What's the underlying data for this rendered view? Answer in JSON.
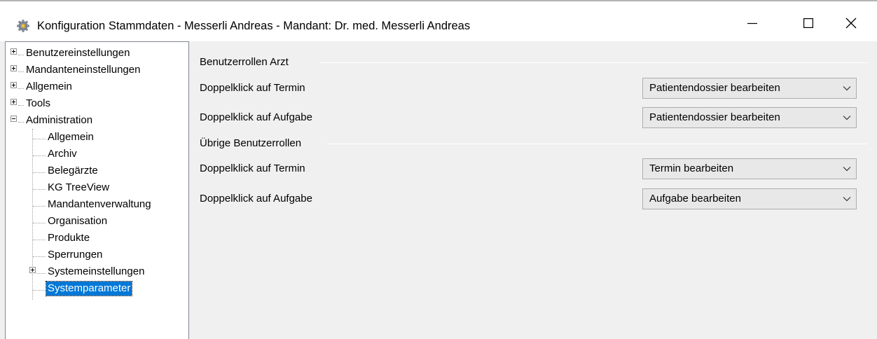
{
  "window": {
    "title": "Konfiguration Stammdaten - Messerli Andreas - Mandant: Dr. med. Messerli Andreas"
  },
  "tree": {
    "nodes": [
      {
        "label": "Benutzereinstellungen",
        "expander": "plus"
      },
      {
        "label": "Mandanteneinstellungen",
        "expander": "plus"
      },
      {
        "label": "Allgemein",
        "expander": "plus"
      },
      {
        "label": "Tools",
        "expander": "plus"
      },
      {
        "label": "Administration",
        "expander": "minus"
      }
    ],
    "admin_children": [
      {
        "label": "Allgemein"
      },
      {
        "label": "Archiv"
      },
      {
        "label": "Belegärzte"
      },
      {
        "label": "KG TreeView"
      },
      {
        "label": "Mandantenverwaltung"
      },
      {
        "label": "Organisation"
      },
      {
        "label": "Produkte"
      },
      {
        "label": "Sperrungen"
      },
      {
        "label": "Systemeinstellungen",
        "expander": "plus"
      },
      {
        "label": "Systemparameter",
        "selected": true
      }
    ]
  },
  "groups": [
    {
      "title": "Benutzerrollen Arzt",
      "fields": [
        {
          "label": "Doppelklick auf Termin",
          "value": "Patientendossier bearbeiten"
        },
        {
          "label": "Doppelklick auf Aufgabe",
          "value": "Patientendossier bearbeiten"
        }
      ]
    },
    {
      "title": "Übrige Benutzerrollen",
      "fields": [
        {
          "label": "Doppelklick auf Termin",
          "value": "Termin bearbeiten"
        },
        {
          "label": "Doppelklick auf Aufgabe",
          "value": "Aufgabe bearbeiten"
        }
      ]
    }
  ],
  "colors": {
    "selection": "#0078d7",
    "window_bg": "#f0f0f0",
    "combo_bg": "#e8e8e8"
  },
  "icons": {
    "app": "settings-gear-icon",
    "minimize": "minimize-icon",
    "maximize": "maximize-icon",
    "close": "close-icon",
    "combo_arrow": "chevron-down-icon"
  }
}
